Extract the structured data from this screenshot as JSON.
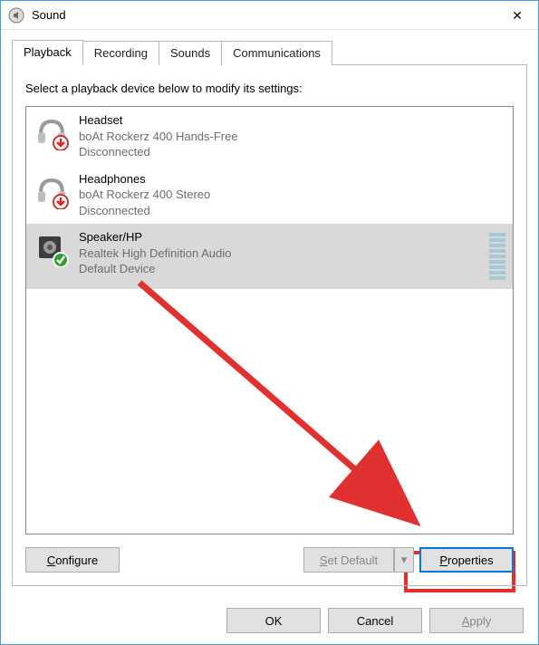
{
  "window": {
    "title": "Sound",
    "close_glyph": "✕"
  },
  "tabs": [
    {
      "label": "Playback",
      "active": true
    },
    {
      "label": "Recording",
      "active": false
    },
    {
      "label": "Sounds",
      "active": false
    },
    {
      "label": "Communications",
      "active": false
    }
  ],
  "instruction": "Select a playback device below to modify its settings:",
  "devices": [
    {
      "name": "Headset",
      "driver": "boAt Rockerz 400 Hands-Free",
      "status": "Disconnected",
      "icon": "headset-icon",
      "badge": "down-arrow",
      "selected": false
    },
    {
      "name": "Headphones",
      "driver": "boAt Rockerz 400 Stereo",
      "status": "Disconnected",
      "icon": "headphones-icon",
      "badge": "down-arrow",
      "selected": false
    },
    {
      "name": "Speaker/HP",
      "driver": "Realtek High Definition Audio",
      "status": "Default Device",
      "icon": "speaker-icon",
      "badge": "check",
      "selected": true
    }
  ],
  "panel_buttons": {
    "configure_prefix": "C",
    "configure_rest": "onfigure",
    "set_default_prefix": "S",
    "set_default_rest": "et Default",
    "dropdown_glyph": "▾",
    "properties_prefix": "P",
    "properties_rest": "roperties"
  },
  "dialog_buttons": {
    "ok": "OK",
    "cancel": "Cancel",
    "apply_prefix": "A",
    "apply_rest": "pply"
  },
  "colors": {
    "highlight": "#e03030",
    "accent": "#0078d7"
  }
}
